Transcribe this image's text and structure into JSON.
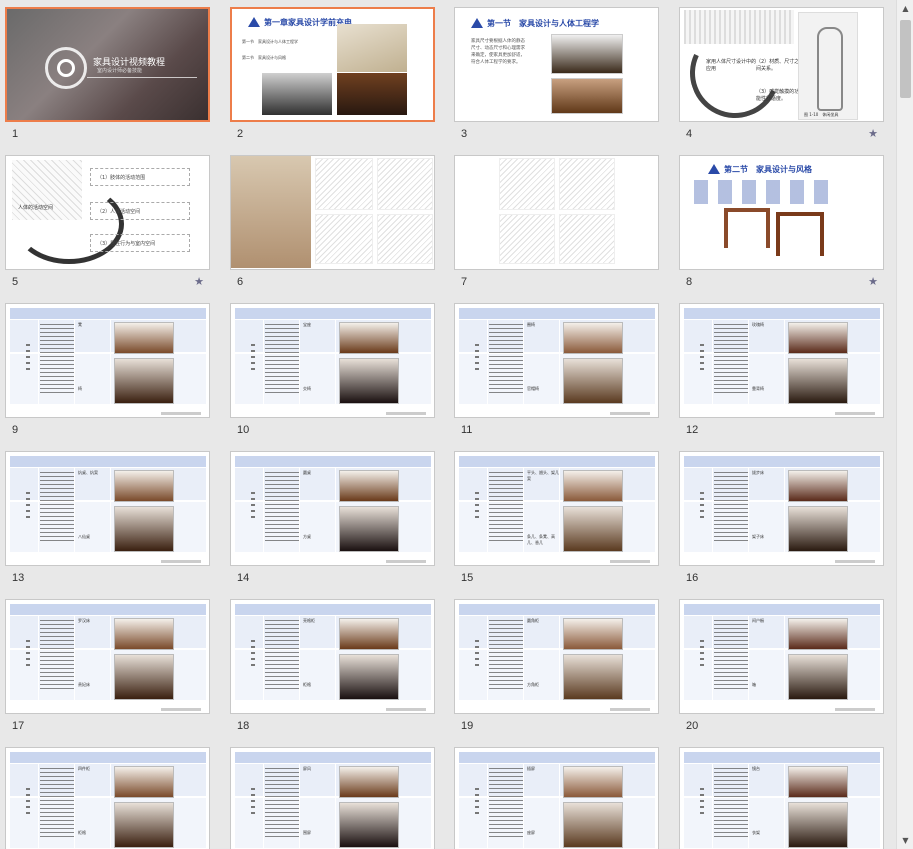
{
  "slides": [
    {
      "num": "1",
      "title": "家具设计视频教程",
      "subtitle": "室内设计师必备技能",
      "selected": true,
      "star": false
    },
    {
      "num": "2",
      "title": "第一章家具设计学前充电",
      "items": [
        "第一节　家具设计与人体工程学",
        "第二节　家具设计与风格"
      ],
      "selected": true,
      "star": false
    },
    {
      "num": "3",
      "title": "第一节　家具设计与人体工程学",
      "body": "家具尺寸要根据人体的静态尺寸、动态尺寸和心理需求来确定，使家具更加舒适，符合人体工程学的要求。"
    },
    {
      "num": "4",
      "texts": [
        "家用人体尺寸设计中的应用",
        "（2）材质、尺寸之间关系。",
        "（3）感觉触摸的功能性舒适度。"
      ],
      "caption": "图 1-10　休闲坐具",
      "star": true
    },
    {
      "num": "5",
      "label": "人体的活动空间",
      "boxes": [
        "（1）肢体的活动范围",
        "（2）人体活动空间",
        "（3）居住行为与室内空间"
      ],
      "star": true
    },
    {
      "num": "6"
    },
    {
      "num": "7"
    },
    {
      "num": "8",
      "title": "第二节　家具设计与风格",
      "star": true
    },
    {
      "num": "9",
      "tags": [
        "凳",
        "椅"
      ]
    },
    {
      "num": "10",
      "tags": [
        "宝座",
        "交椅"
      ]
    },
    {
      "num": "11",
      "tags": [
        "圈椅",
        "官帽椅"
      ]
    },
    {
      "num": "12",
      "tags": [
        "玫瑰椅",
        "靠背椅"
      ]
    },
    {
      "num": "13",
      "tags": [
        "炕桌、炕案",
        "八仙桌"
      ]
    },
    {
      "num": "14",
      "tags": [
        "圆桌",
        "方桌"
      ]
    },
    {
      "num": "15",
      "tags": [
        "平头、翘头、架几案",
        "条几、条凳、高几、香几"
      ]
    },
    {
      "num": "16",
      "tags": [
        "拔步床",
        "架子床"
      ]
    },
    {
      "num": "17",
      "tags": [
        "罗汉床",
        "贵妃床"
      ]
    },
    {
      "num": "18",
      "tags": [
        "亮格柜",
        "柜格"
      ]
    },
    {
      "num": "19",
      "tags": [
        "圆角柜",
        "方角柜"
      ]
    },
    {
      "num": "20",
      "tags": [
        "闷户橱",
        "箱"
      ]
    },
    {
      "num": "21",
      "tags": [
        "四件柜",
        "柜格"
      ]
    },
    {
      "num": "22",
      "tags": [
        "屏风",
        "围屏"
      ]
    },
    {
      "num": "23",
      "tags": [
        "插屏",
        "座屏"
      ]
    },
    {
      "num": "24",
      "tags": [
        "镜台",
        "衣架"
      ]
    }
  ],
  "colors": {
    "selection": "#ed7d4a",
    "accent": "#2a4aa8",
    "table_header": "#c9d5ee"
  },
  "scrollbar": {
    "up_icon": "▲",
    "down_icon": "▼"
  },
  "star_icon": "★"
}
